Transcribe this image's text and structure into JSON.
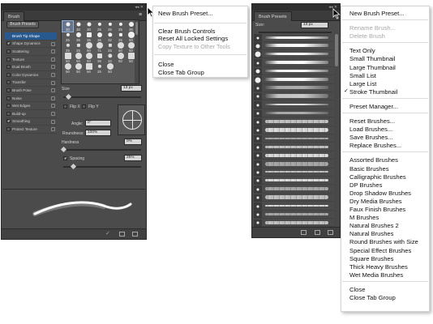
{
  "brush_panel": {
    "tab_label": "Brush",
    "presets_button": "Brush Presets",
    "options": [
      {
        "label": "Brush Tip Shape",
        "checked": false,
        "active": true
      },
      {
        "label": "Shape Dynamics",
        "checked": true,
        "active": false
      },
      {
        "label": "Scattering",
        "checked": false,
        "active": false
      },
      {
        "label": "Texture",
        "checked": false,
        "active": false
      },
      {
        "label": "Dual Brush",
        "checked": false,
        "active": false
      },
      {
        "label": "Color Dynamics",
        "checked": false,
        "active": false
      },
      {
        "label": "Transfer",
        "checked": false,
        "active": false
      },
      {
        "label": "Brush Pose",
        "checked": false,
        "active": false
      },
      {
        "label": "Noise",
        "checked": false,
        "active": false
      },
      {
        "label": "Wet Edges",
        "checked": false,
        "active": false
      },
      {
        "label": "Build-up",
        "checked": false,
        "active": false
      },
      {
        "label": "Smoothing",
        "checked": true,
        "active": false
      },
      {
        "label": "Protect Texture",
        "checked": false,
        "active": false
      }
    ],
    "tip_sizes": [
      "30",
      "30",
      "30",
      "25",
      "25",
      "25",
      "36",
      "25",
      "36",
      "36",
      "36",
      "32",
      "25",
      "50",
      "25",
      "25",
      "50",
      "71",
      "25",
      "50",
      "50",
      "50",
      "50",
      "50",
      "36",
      "32",
      "50",
      "50",
      "50",
      "50",
      "50",
      "25",
      "50"
    ],
    "size_label": "Size",
    "size_value": "13 px",
    "flip_x": "Flip X",
    "flip_y": "Flip Y",
    "angle_label": "Angle:",
    "angle_value": "0°",
    "roundness_label": "Roundness:",
    "roundness_value": "100%",
    "hardness_label": "Hardness",
    "hardness_value": "0%",
    "spacing_label": "Spacing",
    "spacing_value": "25%",
    "spacing_checked": true
  },
  "brush_menu": {
    "items": [
      {
        "label": "New Brush Preset...",
        "disabled": false
      },
      {
        "label": "Clear Brush Controls",
        "disabled": false
      },
      {
        "label": "Reset All Locked Settings",
        "disabled": false
      },
      {
        "label": "Copy Texture to Other Tools",
        "disabled": true
      },
      {
        "label": "Close",
        "disabled": false
      },
      {
        "label": "Close Tab Group",
        "disabled": false
      }
    ]
  },
  "presets_panel": {
    "tab_label": "Brush Presets",
    "size_label": "Size:",
    "size_value": "13 px"
  },
  "presets_menu": {
    "items": [
      {
        "label": "New Brush Preset...",
        "disabled": false,
        "checked": false
      },
      {
        "label": "Rename Brush...",
        "disabled": true,
        "checked": false
      },
      {
        "label": "Delete Brush",
        "disabled": true,
        "checked": false
      },
      {
        "label": "Text Only",
        "disabled": false,
        "checked": false
      },
      {
        "label": "Small Thumbnail",
        "disabled": false,
        "checked": false
      },
      {
        "label": "Large Thumbnail",
        "disabled": false,
        "checked": false
      },
      {
        "label": "Small List",
        "disabled": false,
        "checked": false
      },
      {
        "label": "Large List",
        "disabled": false,
        "checked": false
      },
      {
        "label": "Stroke Thumbnail",
        "disabled": false,
        "checked": true
      },
      {
        "label": "Preset Manager...",
        "disabled": false,
        "checked": false
      },
      {
        "label": "Reset Brushes...",
        "disabled": false,
        "checked": false
      },
      {
        "label": "Load Brushes...",
        "disabled": false,
        "checked": false
      },
      {
        "label": "Save Brushes...",
        "disabled": false,
        "checked": false
      },
      {
        "label": "Replace Brushes...",
        "disabled": false,
        "checked": false
      },
      {
        "label": "Assorted Brushes",
        "disabled": false,
        "checked": false
      },
      {
        "label": "Basic Brushes",
        "disabled": false,
        "checked": false
      },
      {
        "label": "Calligraphic Brushes",
        "disabled": false,
        "checked": false
      },
      {
        "label": "DP Brushes",
        "disabled": false,
        "checked": false
      },
      {
        "label": "Drop Shadow Brushes",
        "disabled": false,
        "checked": false
      },
      {
        "label": "Dry Media Brushes",
        "disabled": false,
        "checked": false
      },
      {
        "label": "Faux Finish Brushes",
        "disabled": false,
        "checked": false
      },
      {
        "label": "M Brushes",
        "disabled": false,
        "checked": false
      },
      {
        "label": "Natural Brushes 2",
        "disabled": false,
        "checked": false
      },
      {
        "label": "Natural Brushes",
        "disabled": false,
        "checked": false
      },
      {
        "label": "Round Brushes with Size",
        "disabled": false,
        "checked": false
      },
      {
        "label": "Special Effect Brushes",
        "disabled": false,
        "checked": false
      },
      {
        "label": "Square Brushes",
        "disabled": false,
        "checked": false
      },
      {
        "label": "Thick Heavy Brushes",
        "disabled": false,
        "checked": false
      },
      {
        "label": "Wet Media Brushes",
        "disabled": false,
        "checked": false
      },
      {
        "label": "Close",
        "disabled": false,
        "checked": false
      },
      {
        "label": "Close Tab Group",
        "disabled": false,
        "checked": false
      }
    ]
  },
  "colors": {
    "panel_bg": "#4b4b4b",
    "active_option": "#27598f",
    "menu_disabled": "#a8a8a8"
  }
}
